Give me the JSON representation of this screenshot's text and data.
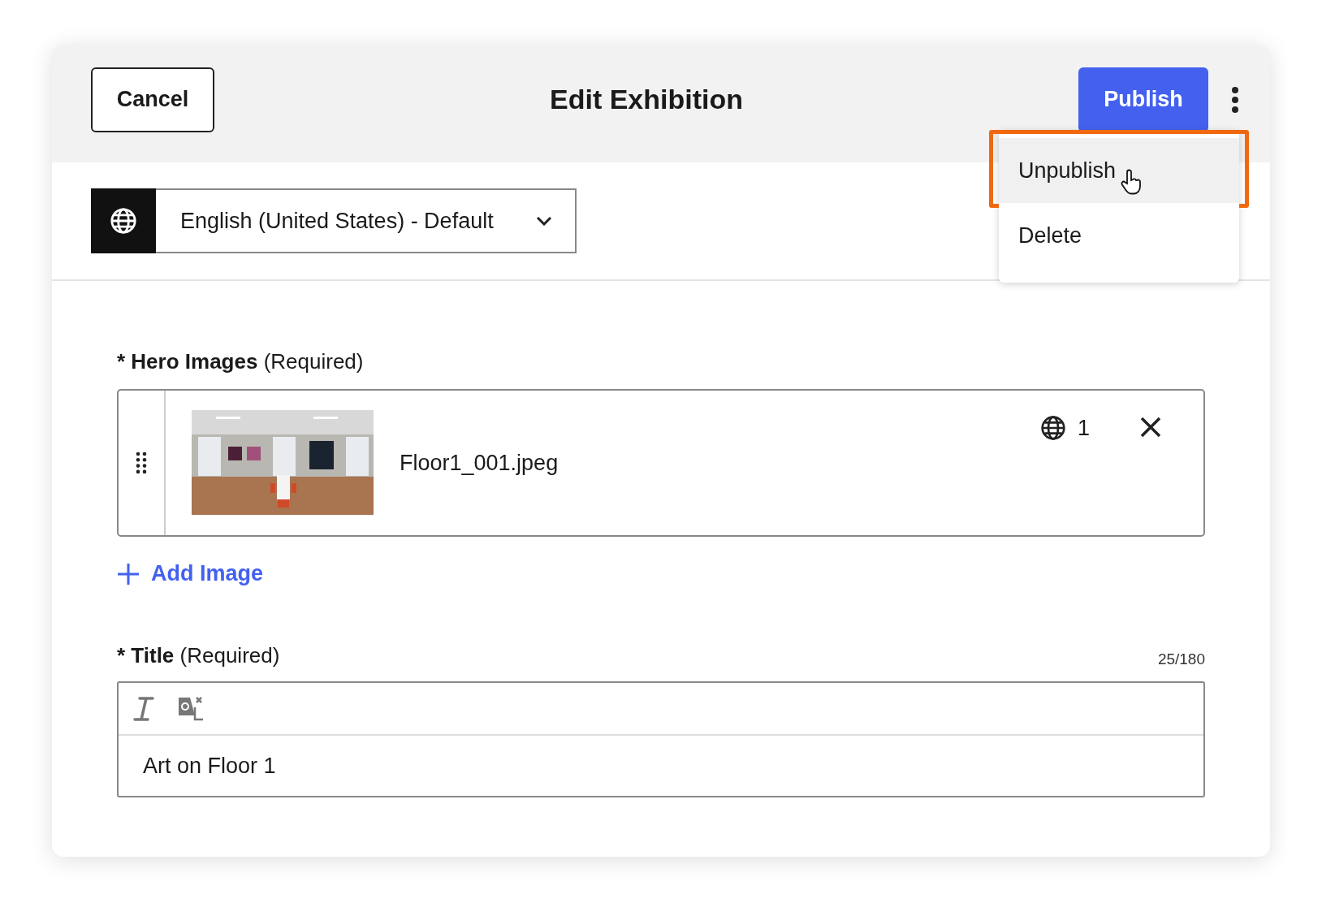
{
  "header": {
    "cancel": "Cancel",
    "title": "Edit Exhibition",
    "publish": "Publish"
  },
  "menu": {
    "items": [
      {
        "label": "Unpublish",
        "highlighted": true,
        "annotated": true
      },
      {
        "label": "Delete",
        "highlighted": false,
        "annotated": false
      }
    ]
  },
  "language": {
    "value": "English (United States) - Default"
  },
  "hero_images": {
    "marker": "*",
    "label": "Hero Images",
    "note": "(Required)",
    "items": [
      {
        "kind": "picture",
        "filename": "Floor1_001.jpeg",
        "locales": "1"
      }
    ],
    "add": "Add Image"
  },
  "title_field": {
    "marker": "*",
    "label": "Title",
    "note": "(Required)",
    "count": "25/180",
    "value": "Art on Floor 1"
  }
}
